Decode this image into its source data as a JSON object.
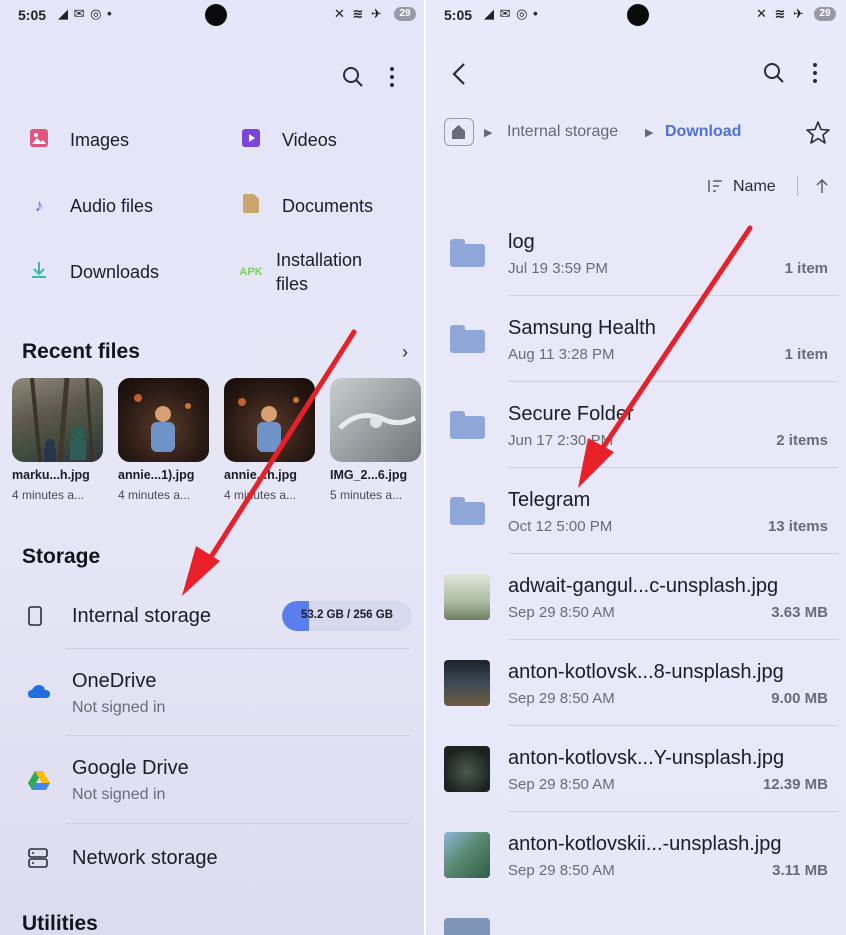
{
  "left": {
    "status": {
      "time": "5:05",
      "battery": "29"
    },
    "categories": [
      {
        "label": "Images",
        "icon": "image-icon"
      },
      {
        "label": "Videos",
        "icon": "video-icon"
      },
      {
        "label": "Audio files",
        "icon": "music-note-icon"
      },
      {
        "label": "Documents",
        "icon": "document-icon"
      },
      {
        "label": "Downloads",
        "icon": "download-icon"
      },
      {
        "label": "Installation\nfiles",
        "icon": "apk-icon",
        "icon_text": "APK"
      }
    ],
    "recent_title": "Recent files",
    "recent": [
      {
        "name": "marku...h.jpg",
        "meta": "4 minutes a..."
      },
      {
        "name": "annie...1).jpg",
        "meta": "4 minutes a..."
      },
      {
        "name": "annie...h.jpg",
        "meta": "4 minutes a..."
      },
      {
        "name": "IMG_2...6.jpg",
        "meta": "5 minutes a..."
      }
    ],
    "storage_title": "Storage",
    "storage": [
      {
        "name": "Internal storage",
        "usage": "53.2 GB / 256 GB",
        "used_fraction": 0.208
      },
      {
        "name": "OneDrive",
        "sub": "Not signed in"
      },
      {
        "name": "Google Drive",
        "sub": "Not signed in"
      },
      {
        "name": "Network storage"
      }
    ],
    "utilities_title": "Utilities"
  },
  "right": {
    "status": {
      "time": "5:05",
      "battery": "29"
    },
    "breadcrumb": {
      "root": "Internal storage",
      "current": "Download"
    },
    "sort_label": "Name",
    "items": [
      {
        "type": "folder",
        "name": "log",
        "date": "Jul 19 3:59 PM",
        "count": "1 item"
      },
      {
        "type": "folder",
        "name": "Samsung Health",
        "date": "Aug 11 3:28 PM",
        "count": "1 item"
      },
      {
        "type": "folder",
        "name": "Secure Folder",
        "date": "Jun 17 2:30 PM",
        "count": "2 items"
      },
      {
        "type": "folder",
        "name": "Telegram",
        "date": "Oct 12 5:00 PM",
        "count": "13 items"
      },
      {
        "type": "file",
        "name": "adwait-gangul...c-unsplash.jpg",
        "date": "Sep 29 8:50 AM",
        "count": "3.63 MB",
        "color": "#b7c3b0"
      },
      {
        "type": "file",
        "name": "anton-kotlovsk...8-unsplash.jpg",
        "date": "Sep 29 8:50 AM",
        "count": "9.00 MB",
        "color": "#3d4a56"
      },
      {
        "type": "file",
        "name": "anton-kotlovsk...Y-unsplash.jpg",
        "date": "Sep 29 8:50 AM",
        "count": "12.39 MB",
        "color": "#2f3a33"
      },
      {
        "type": "file",
        "name": "anton-kotlovskii...-unsplash.jpg",
        "date": "Sep 29 8:50 AM",
        "count": "3.11 MB",
        "color": "#5b8a73"
      }
    ]
  },
  "colors": {
    "accent": "#4f6fe3",
    "arrow": "#e8202a"
  }
}
